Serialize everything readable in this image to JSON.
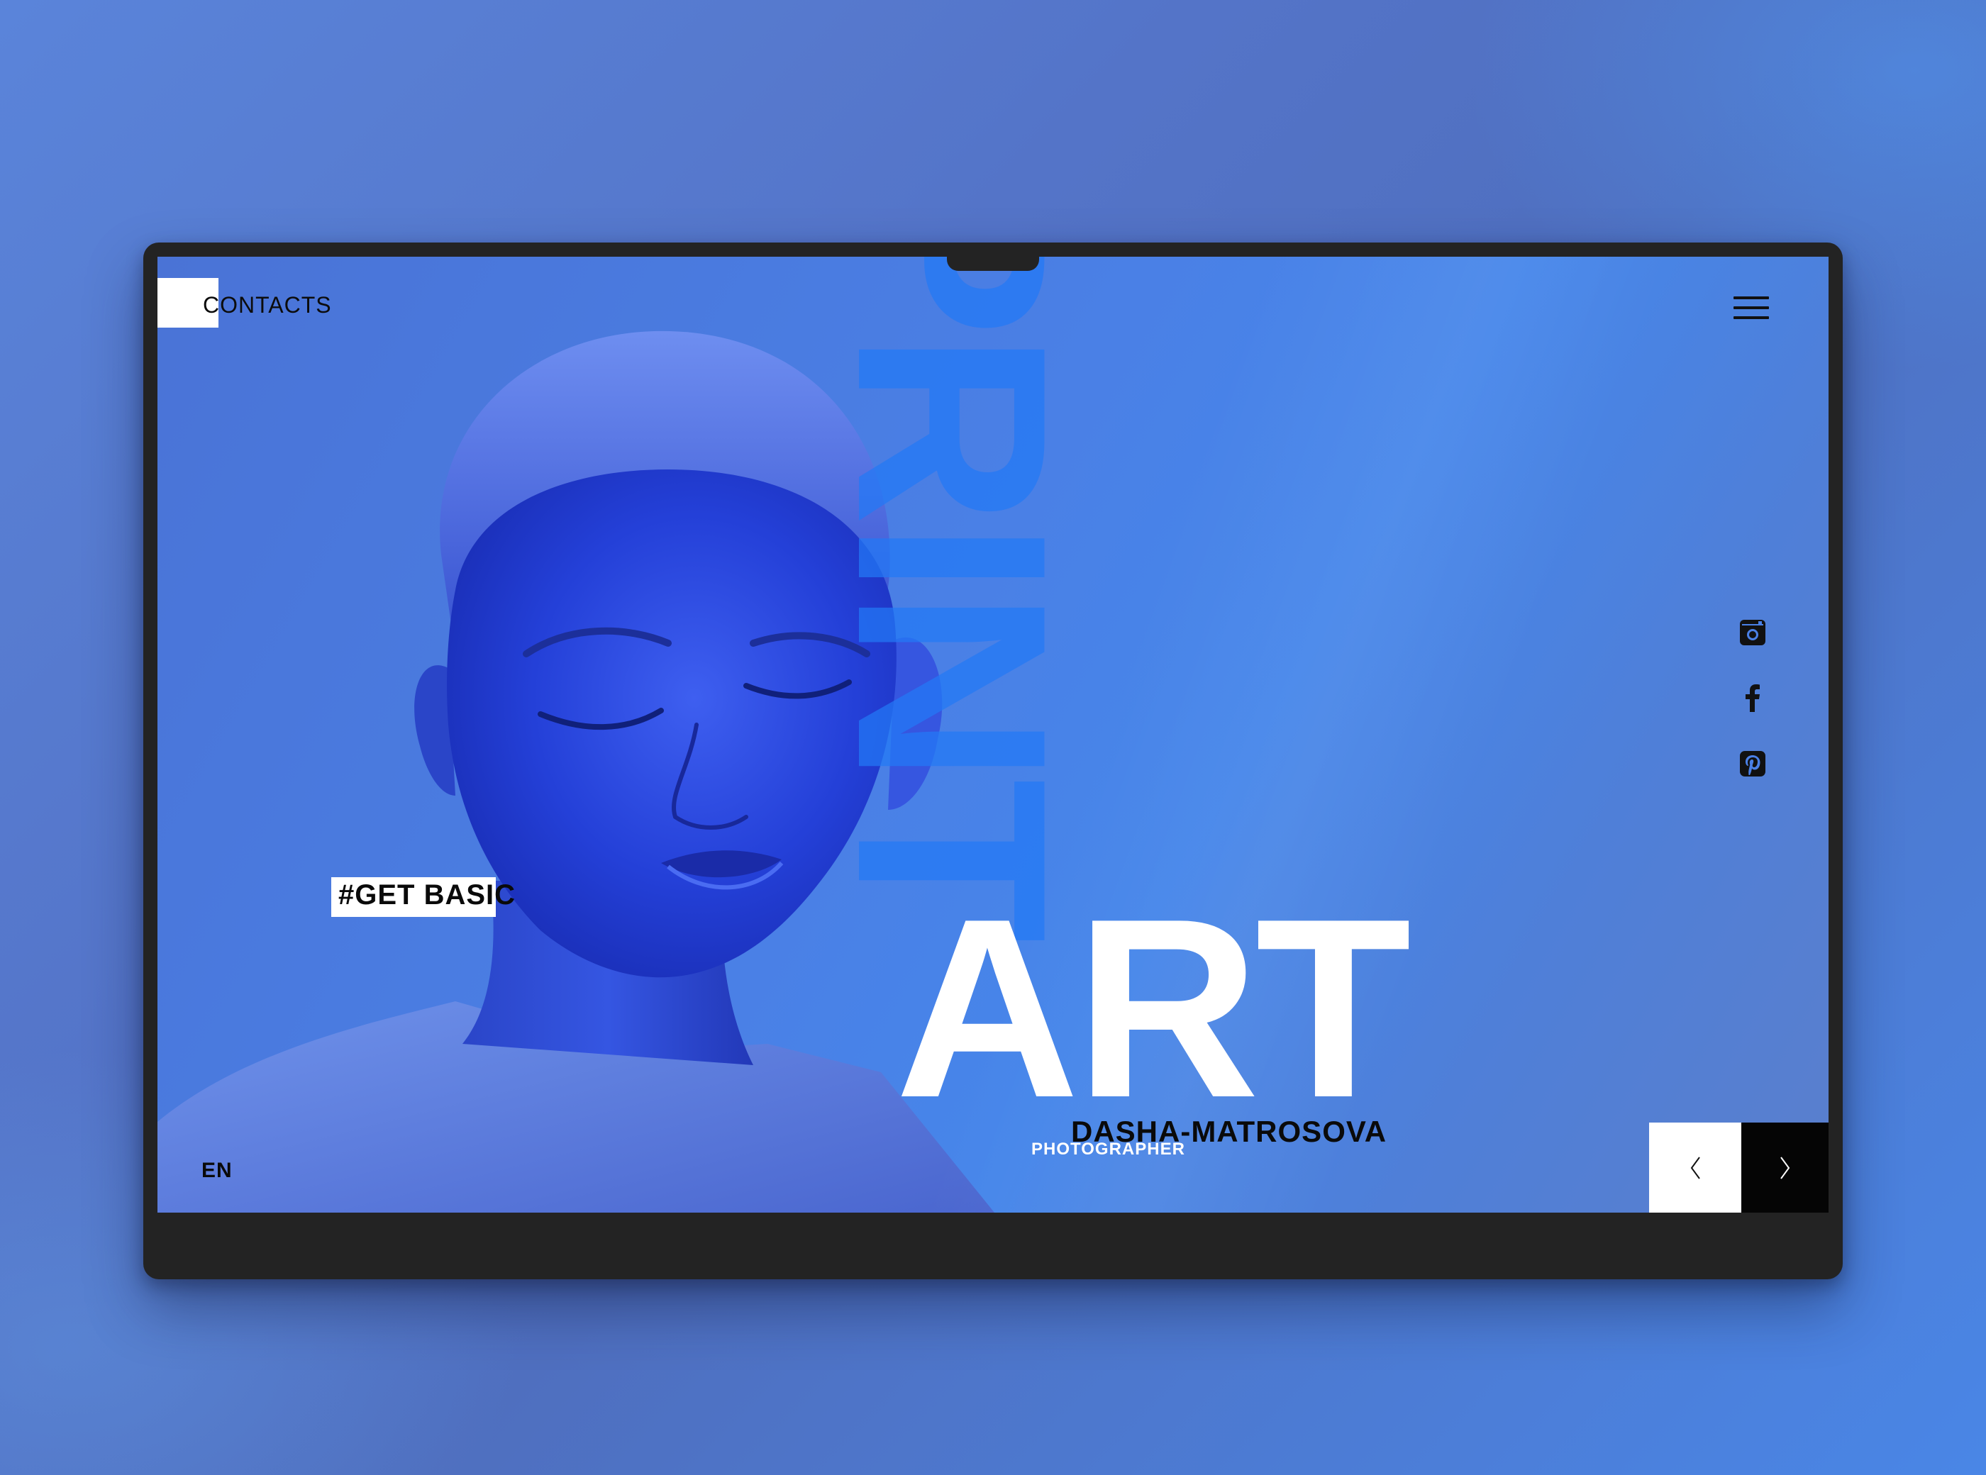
{
  "header": {
    "contacts_label": "CONTACTS"
  },
  "hero": {
    "tag": "#GET BASIC",
    "vertical_word": "PRINT",
    "headline": "ART",
    "photographer_name": "DASHA-MATROSOVA",
    "photographer_role": "PHOTOGRAPHER"
  },
  "footer": {
    "language": "EN"
  },
  "social": {
    "icons": [
      "instagram-icon",
      "facebook-icon",
      "pinterest-icon"
    ]
  },
  "slider": {
    "prev_icon": "chevron-left-icon",
    "next_icon": "chevron-right-icon"
  },
  "colors": {
    "background": "#5474c8",
    "screen": "#4a80e6",
    "print_overlay": "#2378f5",
    "frame": "#232323",
    "text_dark": "#0a0a0a",
    "text_light": "#ffffff"
  }
}
